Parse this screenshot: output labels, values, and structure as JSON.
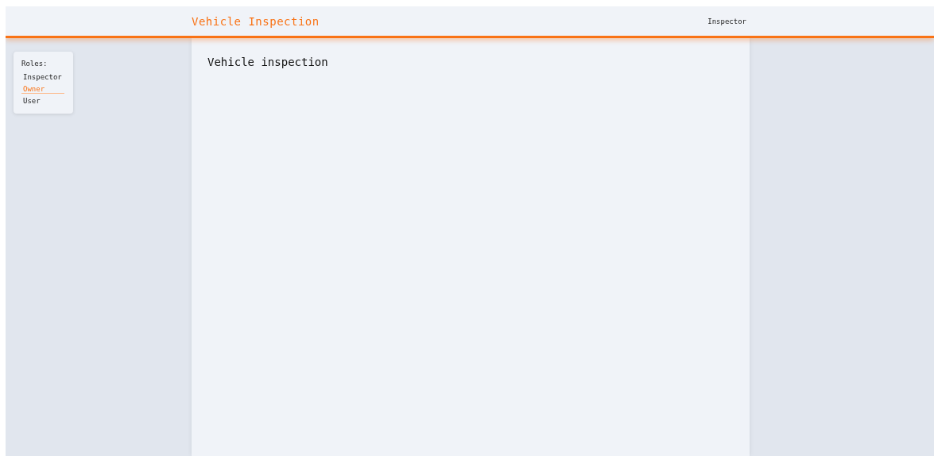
{
  "header": {
    "title": "Vehicle Inspection",
    "current_role": "Inspector"
  },
  "sidebar": {
    "heading": "Roles:",
    "items": [
      {
        "label": "Inspector",
        "selected": false
      },
      {
        "label": "Owner",
        "selected": true
      },
      {
        "label": "User",
        "selected": false
      }
    ]
  },
  "main": {
    "heading": "Vehicle inspection"
  }
}
